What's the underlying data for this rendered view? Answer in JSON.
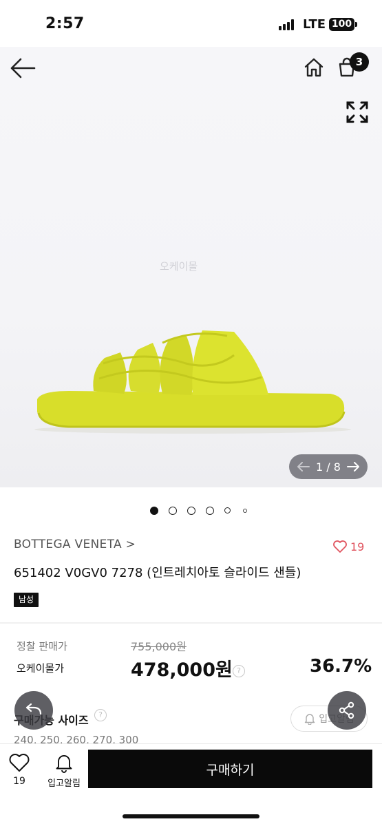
{
  "status_bar": {
    "time": "2:57",
    "network": "LTE",
    "battery": "100"
  },
  "header": {
    "back_icon": "arrow-left-icon",
    "home_icon": "home-icon",
    "cart_icon": "shopping-bag-icon",
    "cart_count": "3",
    "expand_icon": "expand-icon"
  },
  "gallery": {
    "watermark": "오케이몰",
    "counter": "1 / 8",
    "dot_count": 6,
    "active_dot": 0
  },
  "product": {
    "brand": "BOTTEGA VENETA >",
    "title": "651402 V0GV0 7278 (인트레치아토 슬라이드 샌들)",
    "gender_tag": "남성",
    "like_count": "19",
    "color": "#dce32c"
  },
  "pricing": {
    "original_label": "정찰 판매가",
    "original_price": "755,000원",
    "sale_label": "오케이몰가",
    "sale_price": "478,000원",
    "discount": "36.7%"
  },
  "sizes": {
    "label": "구매가능 사이즈",
    "values": "240, 250, 260, 270, 300",
    "restock_label": "입고알림"
  },
  "bottom_bar": {
    "like_count": "19",
    "alert_label": "입고알림",
    "buy_label": "구매하기"
  },
  "colors": {
    "accent_heart": "#e0525d",
    "buy_button": "#0a0a0a"
  }
}
